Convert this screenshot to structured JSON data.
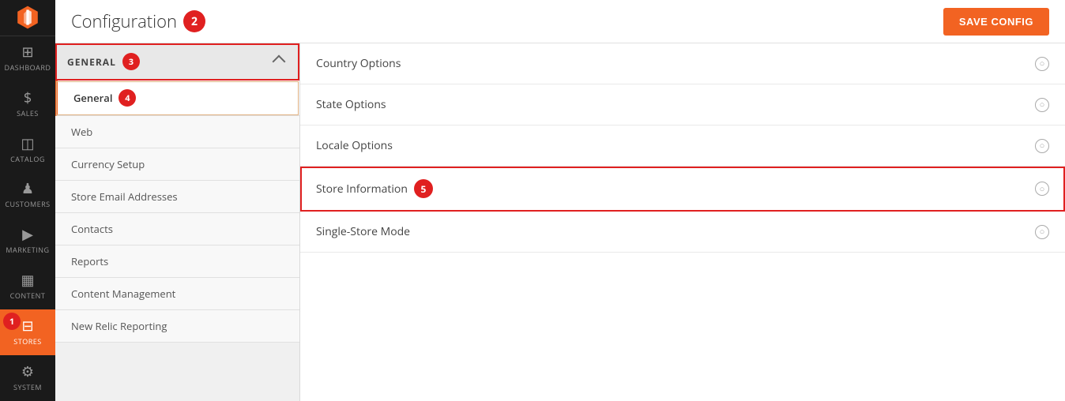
{
  "app": {
    "title": "Configuration",
    "save_button_label": "Save Config"
  },
  "sidebar": {
    "items": [
      {
        "id": "dashboard",
        "label": "DASHBOARD",
        "icon": "⊞",
        "active": false
      },
      {
        "id": "sales",
        "label": "SALES",
        "icon": "$",
        "active": false
      },
      {
        "id": "catalog",
        "label": "CATALOG",
        "icon": "◫",
        "active": false
      },
      {
        "id": "customers",
        "label": "CUSTOMERS",
        "icon": "👤",
        "active": false
      },
      {
        "id": "marketing",
        "label": "MARKETING",
        "icon": "📢",
        "active": false
      },
      {
        "id": "content",
        "label": "CONTENT",
        "icon": "▦",
        "active": false
      },
      {
        "id": "stores",
        "label": "STORES",
        "icon": "🏪",
        "active": true
      },
      {
        "id": "system",
        "label": "SYSTEM",
        "icon": "⚙",
        "active": false
      }
    ]
  },
  "left_panel": {
    "section_label": "GENERAL",
    "annotation_section": "3",
    "sub_items": [
      {
        "id": "general",
        "label": "General",
        "active": true,
        "annotation": "4"
      },
      {
        "id": "web",
        "label": "Web",
        "active": false,
        "annotation": null
      },
      {
        "id": "currency-setup",
        "label": "Currency Setup",
        "active": false,
        "annotation": null
      },
      {
        "id": "store-email",
        "label": "Store Email Addresses",
        "active": false,
        "annotation": null
      },
      {
        "id": "contacts",
        "label": "Contacts",
        "active": false,
        "annotation": null
      },
      {
        "id": "reports",
        "label": "Reports",
        "active": false,
        "annotation": null
      },
      {
        "id": "content-mgmt",
        "label": "Content Management",
        "active": false,
        "annotation": null
      },
      {
        "id": "new-relic",
        "label": "New Relic Reporting",
        "active": false,
        "annotation": null
      }
    ]
  },
  "main_panel": {
    "rows": [
      {
        "id": "country-options",
        "label": "Country Options",
        "highlighted": false
      },
      {
        "id": "state-options",
        "label": "State Options",
        "highlighted": false
      },
      {
        "id": "locale-options",
        "label": "Locale Options",
        "highlighted": false
      },
      {
        "id": "store-information",
        "label": "Store Information",
        "highlighted": true,
        "annotation": "5"
      },
      {
        "id": "single-store-mode",
        "label": "Single-Store Mode",
        "highlighted": false
      }
    ]
  },
  "annotations": {
    "1": "1",
    "2": "2",
    "3": "3",
    "4": "4",
    "5": "5"
  }
}
